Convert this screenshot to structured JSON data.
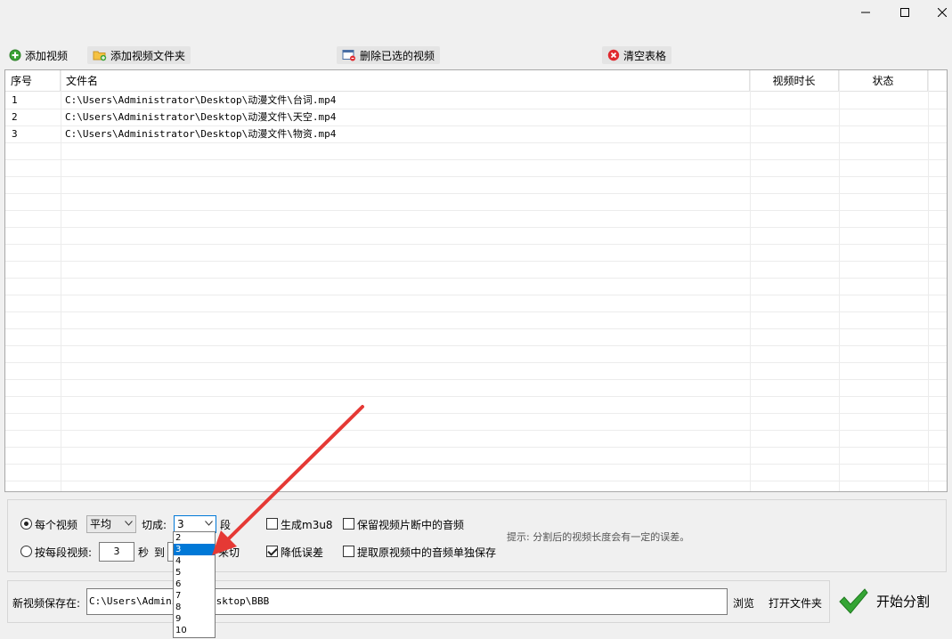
{
  "toolbar": {
    "add_video": "添加视频",
    "add_folder": "添加视频文件夹",
    "delete_selected": "删除已选的视频",
    "clear_table": "清空表格"
  },
  "table": {
    "headers": {
      "index": "序号",
      "filename": "文件名",
      "duration": "视频时长",
      "status": "状态"
    },
    "rows": [
      {
        "index": "1",
        "filename": "C:\\Users\\Administrator\\Desktop\\动漫文件\\台词.mp4"
      },
      {
        "index": "2",
        "filename": "C:\\Users\\Administrator\\Desktop\\动漫文件\\天空.mp4"
      },
      {
        "index": "3",
        "filename": "C:\\Users\\Administrator\\Desktop\\动漫文件\\物资.mp4"
      }
    ]
  },
  "options": {
    "each_video_label": "每个视频",
    "mode_value": "平均",
    "cut_into_label": "切成:",
    "segments_value": "3",
    "segments_unit": "段",
    "per_segment_label": "按每段视频:",
    "seconds_value": "3",
    "seconds_unit": "秒",
    "to_label": "到",
    "cut_suffix": "来切",
    "gen_m3u8": "生成m3u8",
    "reduce_error": "降低误差",
    "keep_audio": "保留视频片断中的音频",
    "extract_audio": "提取原视频中的音频单独保存",
    "hint": "提示: 分割后的视频长度会有一定的误差。"
  },
  "dropdown": {
    "options": [
      "2",
      "3",
      "4",
      "5",
      "6",
      "7",
      "8",
      "9",
      "10"
    ],
    "selected": "3"
  },
  "save": {
    "label": "新视频保存在:",
    "path_left": "C:\\Users\\Adminis",
    "path_right": "esktop\\BBB",
    "browse": "浏览",
    "open_folder": "打开文件夹"
  },
  "start_button": "开始分割",
  "colors": {
    "accent": "#0078d7",
    "arrow": "#e53935",
    "check_green": "#2e9a2e",
    "error_red": "#e0282e"
  }
}
